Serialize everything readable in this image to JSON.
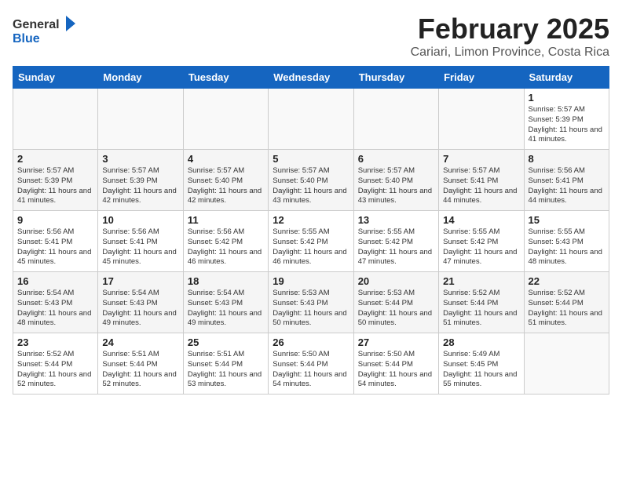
{
  "header": {
    "logo_general": "General",
    "logo_blue": "Blue",
    "month_year": "February 2025",
    "location": "Cariari, Limon Province, Costa Rica"
  },
  "weekdays": [
    "Sunday",
    "Monday",
    "Tuesday",
    "Wednesday",
    "Thursday",
    "Friday",
    "Saturday"
  ],
  "weeks": [
    [
      {
        "day": "",
        "info": ""
      },
      {
        "day": "",
        "info": ""
      },
      {
        "day": "",
        "info": ""
      },
      {
        "day": "",
        "info": ""
      },
      {
        "day": "",
        "info": ""
      },
      {
        "day": "",
        "info": ""
      },
      {
        "day": "1",
        "info": "Sunrise: 5:57 AM\nSunset: 5:39 PM\nDaylight: 11 hours\nand 41 minutes."
      }
    ],
    [
      {
        "day": "2",
        "info": "Sunrise: 5:57 AM\nSunset: 5:39 PM\nDaylight: 11 hours\nand 41 minutes."
      },
      {
        "day": "3",
        "info": "Sunrise: 5:57 AM\nSunset: 5:39 PM\nDaylight: 11 hours\nand 42 minutes."
      },
      {
        "day": "4",
        "info": "Sunrise: 5:57 AM\nSunset: 5:40 PM\nDaylight: 11 hours\nand 42 minutes."
      },
      {
        "day": "5",
        "info": "Sunrise: 5:57 AM\nSunset: 5:40 PM\nDaylight: 11 hours\nand 43 minutes."
      },
      {
        "day": "6",
        "info": "Sunrise: 5:57 AM\nSunset: 5:40 PM\nDaylight: 11 hours\nand 43 minutes."
      },
      {
        "day": "7",
        "info": "Sunrise: 5:57 AM\nSunset: 5:41 PM\nDaylight: 11 hours\nand 44 minutes."
      },
      {
        "day": "8",
        "info": "Sunrise: 5:56 AM\nSunset: 5:41 PM\nDaylight: 11 hours\nand 44 minutes."
      }
    ],
    [
      {
        "day": "9",
        "info": "Sunrise: 5:56 AM\nSunset: 5:41 PM\nDaylight: 11 hours\nand 45 minutes."
      },
      {
        "day": "10",
        "info": "Sunrise: 5:56 AM\nSunset: 5:41 PM\nDaylight: 11 hours\nand 45 minutes."
      },
      {
        "day": "11",
        "info": "Sunrise: 5:56 AM\nSunset: 5:42 PM\nDaylight: 11 hours\nand 46 minutes."
      },
      {
        "day": "12",
        "info": "Sunrise: 5:55 AM\nSunset: 5:42 PM\nDaylight: 11 hours\nand 46 minutes."
      },
      {
        "day": "13",
        "info": "Sunrise: 5:55 AM\nSunset: 5:42 PM\nDaylight: 11 hours\nand 47 minutes."
      },
      {
        "day": "14",
        "info": "Sunrise: 5:55 AM\nSunset: 5:42 PM\nDaylight: 11 hours\nand 47 minutes."
      },
      {
        "day": "15",
        "info": "Sunrise: 5:55 AM\nSunset: 5:43 PM\nDaylight: 11 hours\nand 48 minutes."
      }
    ],
    [
      {
        "day": "16",
        "info": "Sunrise: 5:54 AM\nSunset: 5:43 PM\nDaylight: 11 hours\nand 48 minutes."
      },
      {
        "day": "17",
        "info": "Sunrise: 5:54 AM\nSunset: 5:43 PM\nDaylight: 11 hours\nand 49 minutes."
      },
      {
        "day": "18",
        "info": "Sunrise: 5:54 AM\nSunset: 5:43 PM\nDaylight: 11 hours\nand 49 minutes."
      },
      {
        "day": "19",
        "info": "Sunrise: 5:53 AM\nSunset: 5:43 PM\nDaylight: 11 hours\nand 50 minutes."
      },
      {
        "day": "20",
        "info": "Sunrise: 5:53 AM\nSunset: 5:44 PM\nDaylight: 11 hours\nand 50 minutes."
      },
      {
        "day": "21",
        "info": "Sunrise: 5:52 AM\nSunset: 5:44 PM\nDaylight: 11 hours\nand 51 minutes."
      },
      {
        "day": "22",
        "info": "Sunrise: 5:52 AM\nSunset: 5:44 PM\nDaylight: 11 hours\nand 51 minutes."
      }
    ],
    [
      {
        "day": "23",
        "info": "Sunrise: 5:52 AM\nSunset: 5:44 PM\nDaylight: 11 hours\nand 52 minutes."
      },
      {
        "day": "24",
        "info": "Sunrise: 5:51 AM\nSunset: 5:44 PM\nDaylight: 11 hours\nand 52 minutes."
      },
      {
        "day": "25",
        "info": "Sunrise: 5:51 AM\nSunset: 5:44 PM\nDaylight: 11 hours\nand 53 minutes."
      },
      {
        "day": "26",
        "info": "Sunrise: 5:50 AM\nSunset: 5:44 PM\nDaylight: 11 hours\nand 54 minutes."
      },
      {
        "day": "27",
        "info": "Sunrise: 5:50 AM\nSunset: 5:44 PM\nDaylight: 11 hours\nand 54 minutes."
      },
      {
        "day": "28",
        "info": "Sunrise: 5:49 AM\nSunset: 5:45 PM\nDaylight: 11 hours\nand 55 minutes."
      },
      {
        "day": "",
        "info": ""
      }
    ]
  ]
}
